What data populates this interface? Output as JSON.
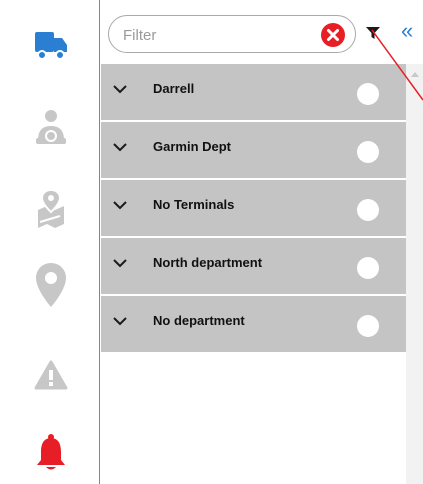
{
  "rail": {
    "items": [
      {
        "icon": "truck-icon",
        "color": "#2a7fd3",
        "active": true
      },
      {
        "icon": "driver-icon",
        "color": "#c7c7c7"
      },
      {
        "icon": "map-pin-route-icon",
        "color": "#c7c7c7"
      },
      {
        "icon": "location-pin-icon",
        "color": "#c7c7c7"
      },
      {
        "icon": "warning-icon",
        "color": "#c7c7c7"
      },
      {
        "icon": "bell-icon",
        "color": "#e81e26"
      }
    ]
  },
  "filter": {
    "placeholder": "Filter",
    "value": "",
    "clear_icon": "clear-icon",
    "funnel_icon": "funnel-icon",
    "collapse_glyph": "«"
  },
  "list": {
    "items": [
      {
        "label": "Darrell"
      },
      {
        "label": "Garmin Dept"
      },
      {
        "label": "No Terminals"
      },
      {
        "label": "North department"
      },
      {
        "label": "No department"
      }
    ]
  },
  "colors": {
    "accent": "#2a7fd3",
    "danger": "#e81e26",
    "row_bg": "#c4c4c4",
    "rail_border": "#2aa3d9"
  }
}
